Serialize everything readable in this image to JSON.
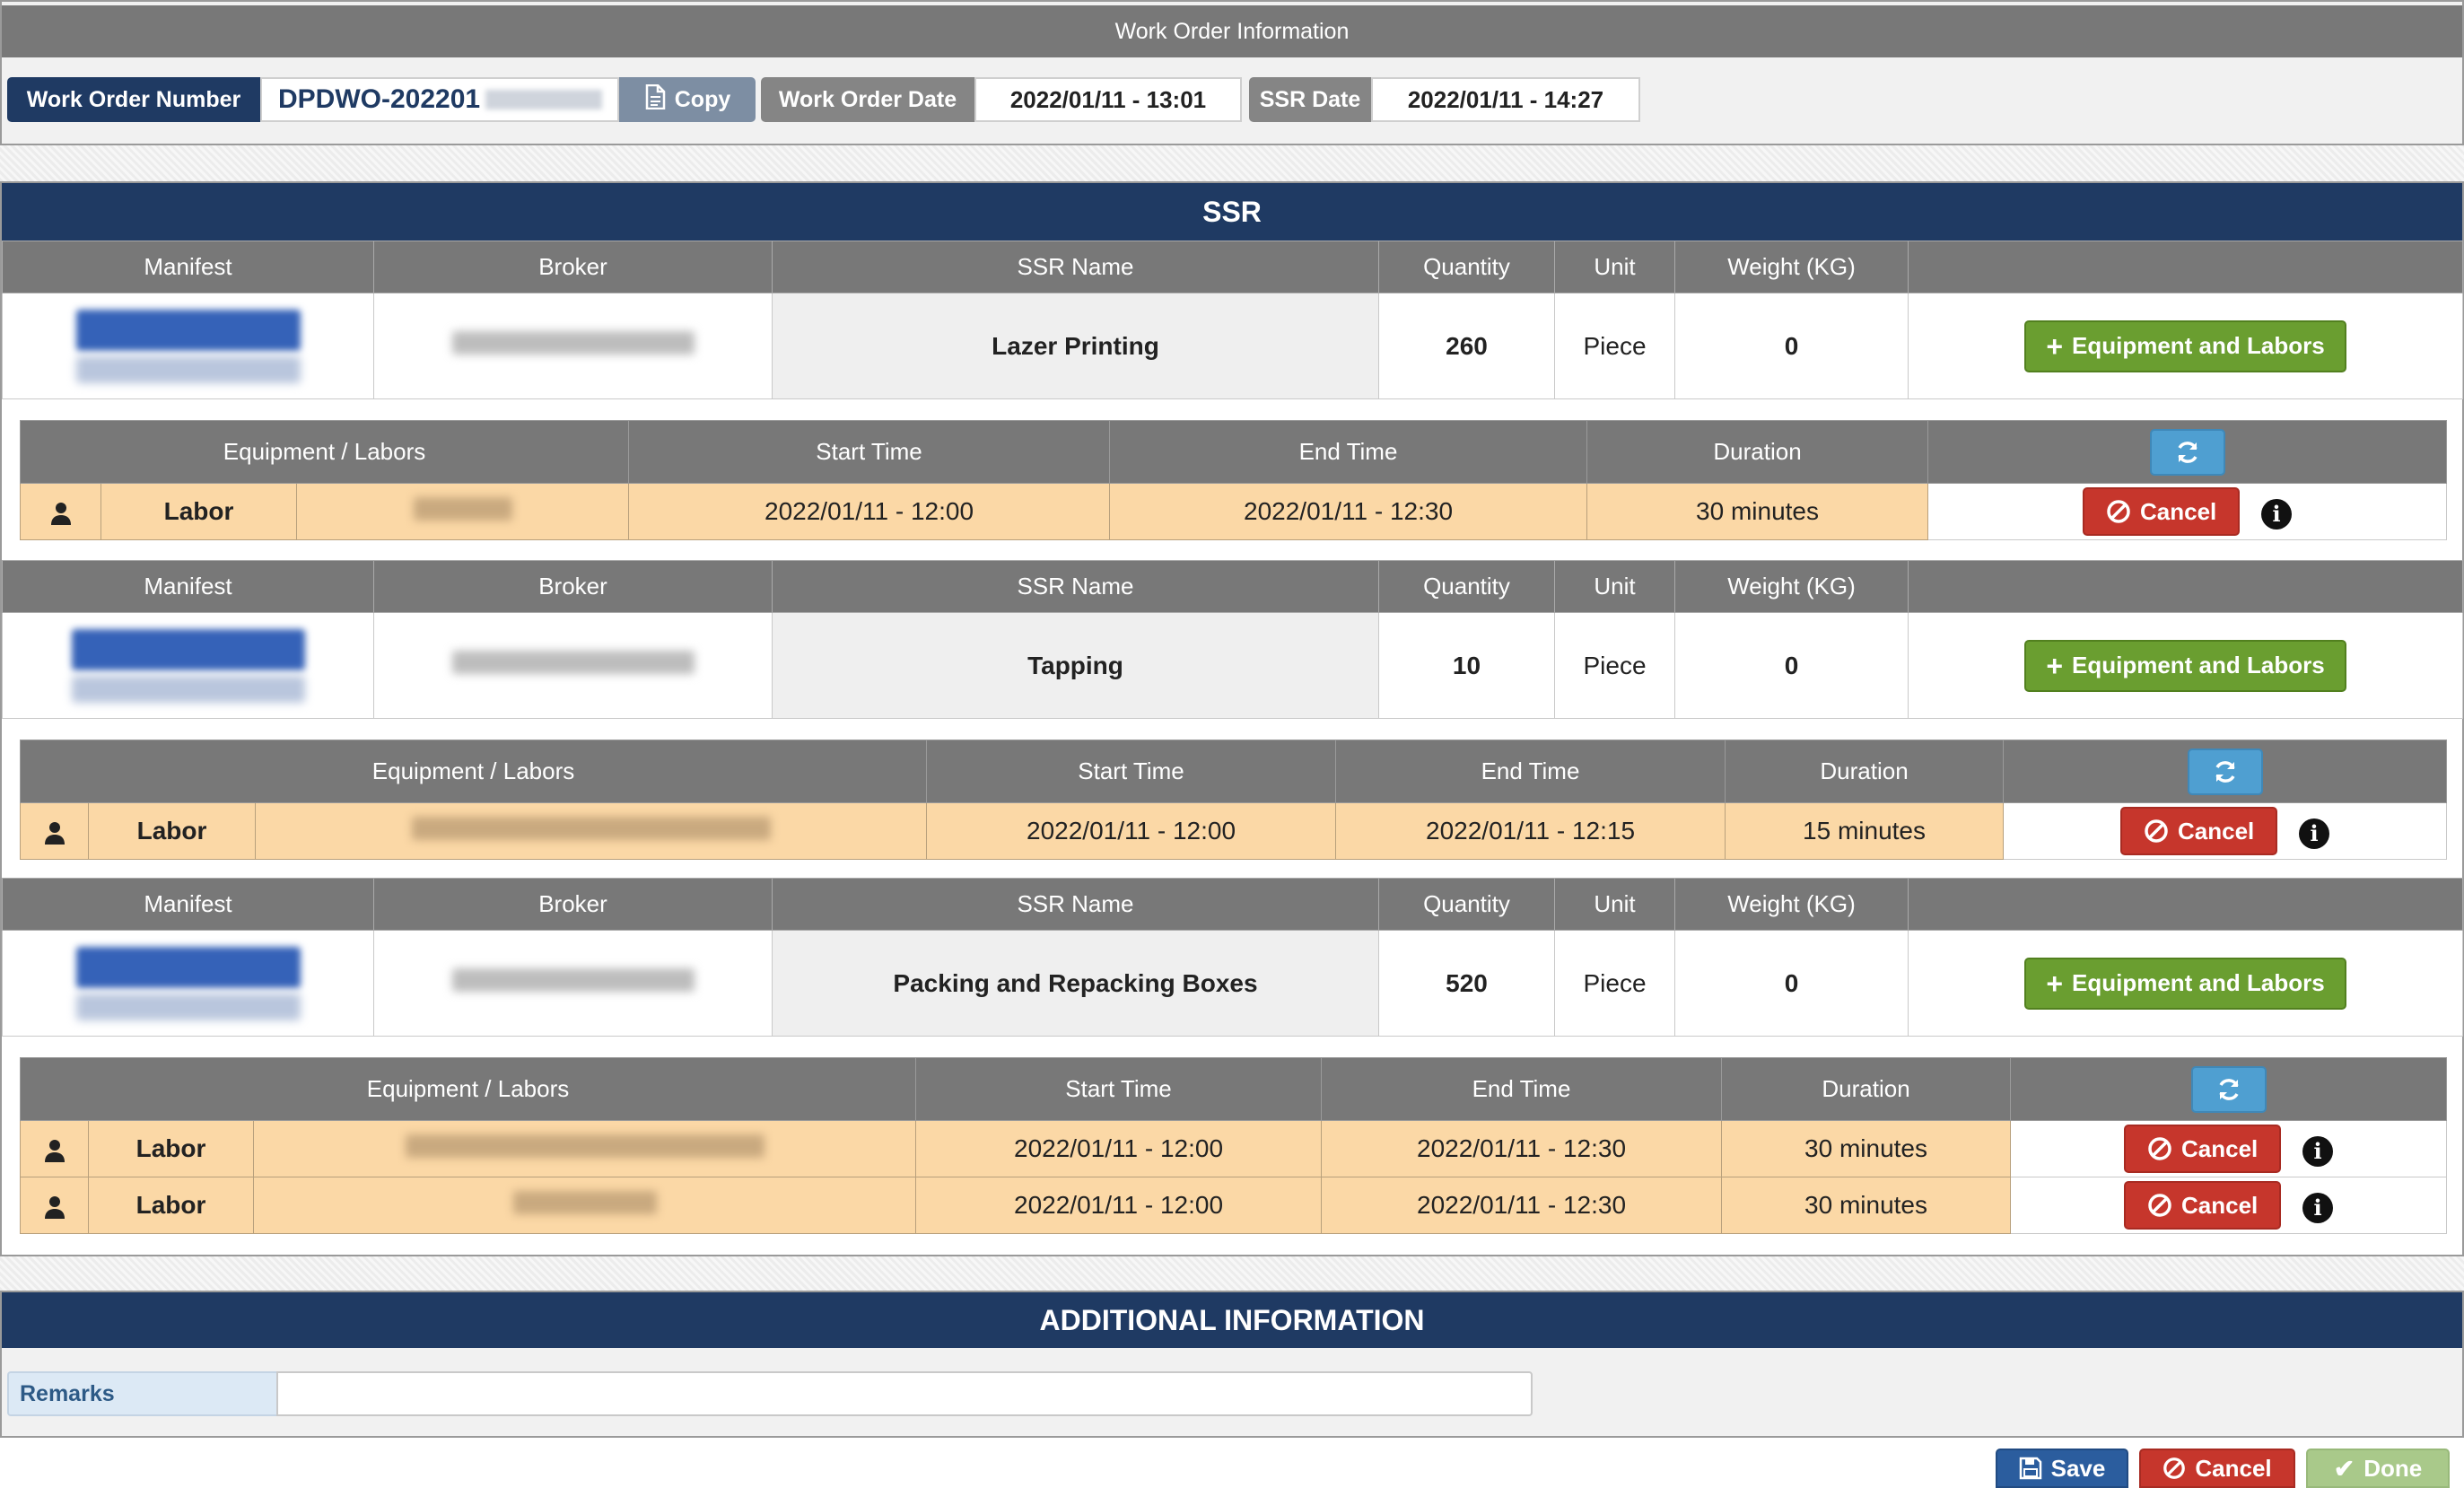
{
  "work_order_panel": {
    "title": "Work Order Information",
    "number_label": "Work Order Number",
    "number_value": "DPDWO-202201",
    "copy_label": "Copy",
    "date_label": "Work Order Date",
    "date_value": "2022/01/11 - 13:01",
    "ssr_date_label": "SSR Date",
    "ssr_date_value": "2022/01/11 - 14:27"
  },
  "ssr_section": {
    "title": "SSR",
    "ssr_headers": [
      "Manifest",
      "Broker",
      "SSR Name",
      "Quantity",
      "Unit",
      "Weight (KG)"
    ],
    "eq_headers": [
      "Equipment / Labors",
      "Start Time",
      "End Time",
      "Duration"
    ],
    "add_button_label": "Equipment and Labors",
    "cancel_label": "Cancel",
    "items": [
      {
        "ssr_name": "Lazer Printing",
        "quantity": "260",
        "unit": "Piece",
        "weight": "0",
        "labors": [
          {
            "type": "Labor",
            "start": "2022/01/11 - 12:00",
            "end": "2022/01/11 - 12:30",
            "duration": "30 minutes"
          }
        ]
      },
      {
        "ssr_name": "Tapping",
        "quantity": "10",
        "unit": "Piece",
        "weight": "0",
        "labors": [
          {
            "type": "Labor",
            "start": "2022/01/11 - 12:00",
            "end": "2022/01/11 - 12:15",
            "duration": "15 minutes"
          }
        ]
      },
      {
        "ssr_name": "Packing and Repacking Boxes",
        "quantity": "520",
        "unit": "Piece",
        "weight": "0",
        "labors": [
          {
            "type": "Labor",
            "start": "2022/01/11 - 12:00",
            "end": "2022/01/11 - 12:30",
            "duration": "30 minutes"
          },
          {
            "type": "Labor",
            "start": "2022/01/11 - 12:00",
            "end": "2022/01/11 - 12:30",
            "duration": "30 minutes"
          }
        ]
      }
    ]
  },
  "additional_info": {
    "title": "ADDITIONAL INFORMATION",
    "remarks_label": "Remarks",
    "remarks_value": ""
  },
  "footer": {
    "save_label": "Save",
    "cancel_label": "Cancel",
    "done_label": "Done"
  },
  "colors": {
    "navy": "#1f3a63",
    "header_gray": "#787878",
    "labor_row": "#fbd8a6",
    "green": "#6a9e30",
    "red": "#c6362c",
    "refresh_blue": "#4f9fd1"
  }
}
